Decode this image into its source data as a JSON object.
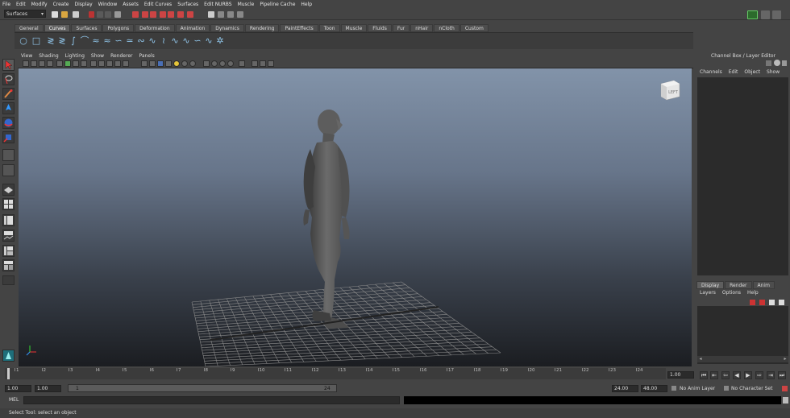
{
  "menubar": [
    "File",
    "Edit",
    "Modify",
    "Create",
    "Display",
    "Window",
    "Assets",
    "Edit Curves",
    "Surfaces",
    "Edit NURBS",
    "Muscle",
    "Pipeline Cache",
    "Help"
  ],
  "status": {
    "menu_set": "Surfaces"
  },
  "shelf": {
    "tabs": [
      "General",
      "Curves",
      "Surfaces",
      "Polygons",
      "Deformation",
      "Animation",
      "Dynamics",
      "Rendering",
      "PaintEffects",
      "Toon",
      "Muscle",
      "Fluids",
      "Fur",
      "nHair",
      "nCloth",
      "Custom"
    ],
    "active_tab": "Curves"
  },
  "panel": {
    "menu": [
      "View",
      "Shading",
      "Lighting",
      "Show",
      "Renderer",
      "Panels"
    ]
  },
  "viewcube": {
    "label": "LEFT"
  },
  "channel_box": {
    "title": "Channel Box / Layer Editor",
    "menu": [
      "Channels",
      "Edit",
      "Object",
      "Show"
    ]
  },
  "layer_editor": {
    "tabs": [
      "Display",
      "Render",
      "Anim"
    ],
    "active_tab": "Display",
    "menu": [
      "Layers",
      "Options",
      "Help"
    ]
  },
  "time_slider": {
    "ticks": [
      "1",
      "2",
      "3",
      "4",
      "5",
      "6",
      "7",
      "8",
      "9",
      "10",
      "11",
      "12",
      "13",
      "14",
      "15",
      "16",
      "17",
      "18",
      "19",
      "20",
      "21",
      "22",
      "23",
      "24"
    ],
    "current_frame": "1.00"
  },
  "range": {
    "start": "1.00",
    "current": "1.00",
    "range_start": "1",
    "range_end": "24",
    "end": "24.00",
    "total_end": "48.00",
    "anim_layer": "No Anim Layer",
    "character_set": "No Character Set"
  },
  "mel": {
    "label": "MEL"
  },
  "help_line": "Select Tool: select an object",
  "colors": {
    "viewport_top": "#8293a9",
    "viewport_bottom": "#1b1d21",
    "ui_bg": "#444444",
    "panel_dark": "#2b2b2b",
    "curve_icon": "#8fc4e8"
  }
}
